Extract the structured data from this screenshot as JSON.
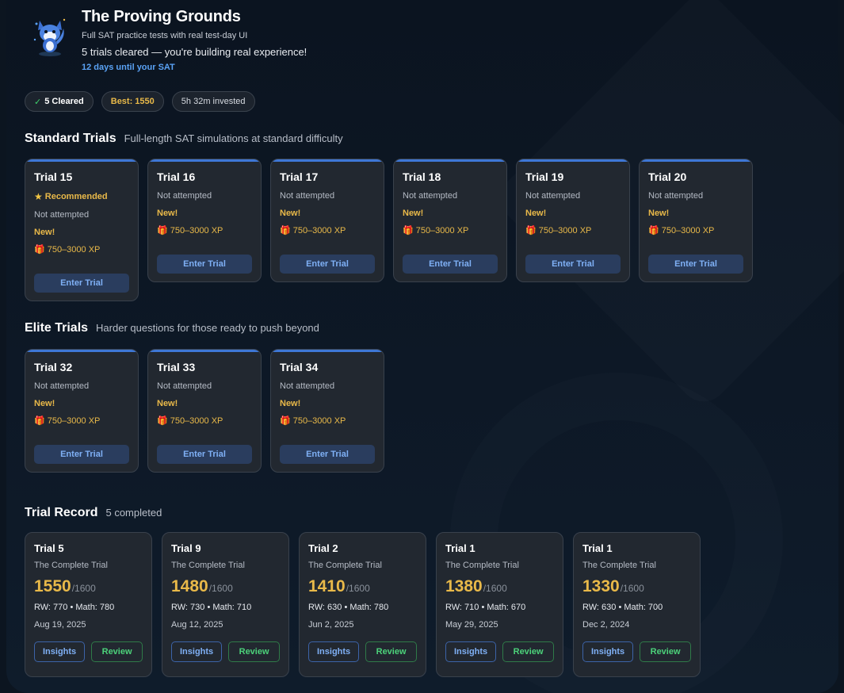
{
  "header": {
    "title": "The Proving Grounds",
    "subtitle": "Full SAT practice tests with real test-day UI",
    "progress_message": "5 trials cleared — you're building real experience!",
    "countdown": "12 days until your SAT"
  },
  "stats": {
    "cleared": "5 Cleared",
    "best": "Best: 1550",
    "time": "5h 32m invested"
  },
  "standard": {
    "title": "Standard Trials",
    "subtitle": "Full-length SAT simulations at standard difficulty",
    "trials": [
      {
        "name": "Trial 15",
        "recommended": "Recommended",
        "status": "Not attempted",
        "badge": "New!",
        "xp": "750–3000 XP",
        "button": "Enter Trial"
      },
      {
        "name": "Trial 16",
        "status": "Not attempted",
        "badge": "New!",
        "xp": "750–3000 XP",
        "button": "Enter Trial"
      },
      {
        "name": "Trial 17",
        "status": "Not attempted",
        "badge": "New!",
        "xp": "750–3000 XP",
        "button": "Enter Trial"
      },
      {
        "name": "Trial 18",
        "status": "Not attempted",
        "badge": "New!",
        "xp": "750–3000 XP",
        "button": "Enter Trial"
      },
      {
        "name": "Trial 19",
        "status": "Not attempted",
        "badge": "New!",
        "xp": "750–3000 XP",
        "button": "Enter Trial"
      },
      {
        "name": "Trial 20",
        "status": "Not attempted",
        "badge": "New!",
        "xp": "750–3000 XP",
        "button": "Enter Trial"
      }
    ]
  },
  "elite": {
    "title": "Elite Trials",
    "subtitle": "Harder questions for those ready to push beyond",
    "trials": [
      {
        "name": "Trial 32",
        "status": "Not attempted",
        "badge": "New!",
        "xp": "750–3000 XP",
        "button": "Enter Trial"
      },
      {
        "name": "Trial 33",
        "status": "Not attempted",
        "badge": "New!",
        "xp": "750–3000 XP",
        "button": "Enter Trial"
      },
      {
        "name": "Trial 34",
        "status": "Not attempted",
        "badge": "New!",
        "xp": "750–3000 XP",
        "button": "Enter Trial"
      }
    ]
  },
  "record": {
    "title": "Trial Record",
    "subtitle": "5 completed",
    "entries": [
      {
        "name": "Trial 5",
        "test": "The Complete Trial",
        "score": "1550",
        "max": "/1600",
        "breakdown": "RW: 770 • Math: 780",
        "date": "Aug 19, 2025",
        "insights": "Insights",
        "review": "Review"
      },
      {
        "name": "Trial 9",
        "test": "The Complete Trial",
        "score": "1480",
        "max": "/1600",
        "breakdown": "RW: 730 • Math: 710",
        "date": "Aug 12, 2025",
        "insights": "Insights",
        "review": "Review"
      },
      {
        "name": "Trial 2",
        "test": "The Complete Trial",
        "score": "1410",
        "max": "/1600",
        "breakdown": "RW: 630 • Math: 780",
        "date": "Jun 2, 2025",
        "insights": "Insights",
        "review": "Review"
      },
      {
        "name": "Trial 1",
        "test": "The Complete Trial",
        "score": "1380",
        "max": "/1600",
        "breakdown": "RW: 710 • Math: 670",
        "date": "May 29, 2025",
        "insights": "Insights",
        "review": "Review"
      },
      {
        "name": "Trial 1",
        "test": "The Complete Trial",
        "score": "1330",
        "max": "/1600",
        "breakdown": "RW: 630 • Math: 700",
        "date": "Dec 2, 2024",
        "insights": "Insights",
        "review": "Review"
      }
    ]
  },
  "icons": {
    "mascot": "fox-mascot-icon",
    "check": "check-icon",
    "star": "star-icon",
    "gift": "gift-icon"
  },
  "colors": {
    "accent_blue": "#5aa2f5",
    "gold": "#e9b949",
    "green": "#4cd27a",
    "card_bg": "#222830",
    "page_bg": "#0c1520"
  }
}
